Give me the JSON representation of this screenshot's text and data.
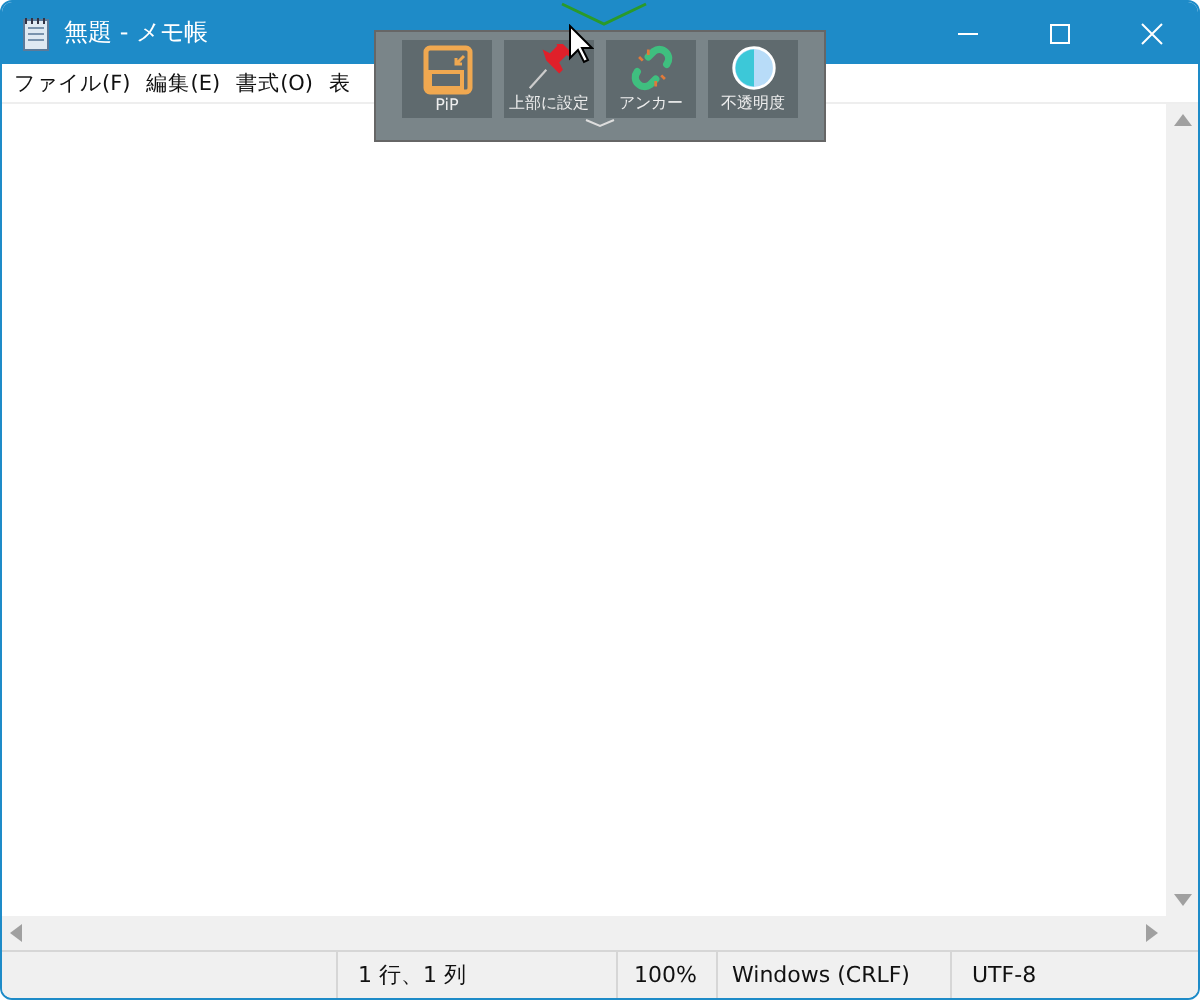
{
  "window": {
    "title": "無題 - メモ帳"
  },
  "menu": [
    {
      "label": "ファイル(F)"
    },
    {
      "label": "編集(E)"
    },
    {
      "label": "書式(O)"
    },
    {
      "label": "表"
    }
  ],
  "overlay": {
    "buttons": [
      {
        "kind": "pip",
        "label": "PiP"
      },
      {
        "kind": "pin",
        "label": "上部に設定"
      },
      {
        "kind": "anchor",
        "label": "アンカー"
      },
      {
        "kind": "opacity",
        "label": "不透明度"
      }
    ]
  },
  "status_bar": [
    "1 行、1 列",
    "100%",
    "Windows (CRLF)",
    "UTF-8"
  ]
}
